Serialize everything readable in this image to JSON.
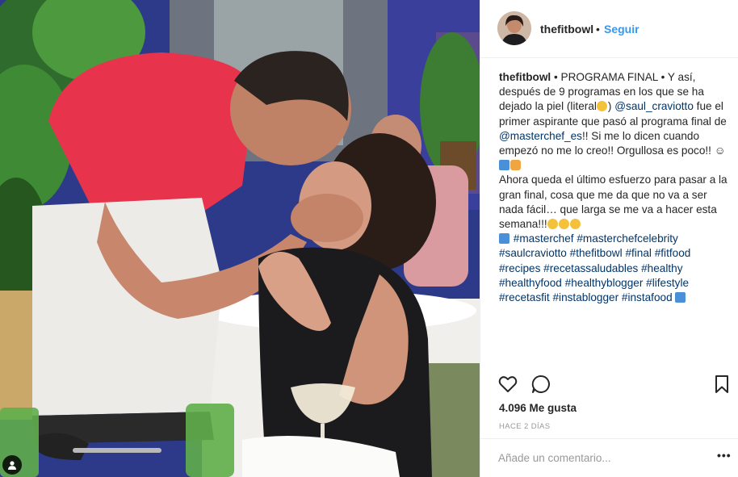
{
  "post": {
    "username": "thefitbowl",
    "separator": "•",
    "follow_label": "Seguir",
    "caption": {
      "p1_user": "thefitbowl",
      "p1_text": " • PROGRAMA FINAL • Y así, después de 9 programas en los que se ha dejado la piel (literal",
      "p1_close": ") ",
      "mention1": "@saul_craviotto",
      "p2_text": " fue el primer aspirante que pasó al programa final de ",
      "mention2": "@masterchef_es",
      "p3_text": "!! Si me lo dicen cuando empezó no me lo creo!! Orgullosa es poco!! ☺",
      "p4_text": "Ahora queda el último esfuerzo para pasar a la gran final, cosa que me da que no va a ser nada fácil… que larga se me va a hacer esta semana!!!",
      "hashtags": [
        "#masterchef",
        "#masterchefcelebrity",
        "#saulcraviotto",
        "#thefitbowl",
        "#final",
        "#fitfood",
        "#recipes",
        "#recetassaludables",
        "#healthy",
        "#healthyfood",
        "#healthyblogger",
        "#lifestyle",
        "#recetasfit",
        "#instablogger",
        "#instafood"
      ]
    },
    "likes": "4.096 Me gusta",
    "time_ago": "HACE 2 DÍAS",
    "comment_placeholder": "Añade un comentario...",
    "more_label": "•••"
  },
  "colors": {
    "accent": "#3897f0",
    "link": "#003569",
    "text": "#262626",
    "muted": "#999999",
    "border": "#efefef"
  },
  "icons": {
    "like": "heart-icon",
    "comment": "comment-bubble-icon",
    "save": "bookmark-icon",
    "tag": "user-tag-icon",
    "play": "play-emoji-icon",
    "back": "back-arrow-emoji-icon"
  }
}
